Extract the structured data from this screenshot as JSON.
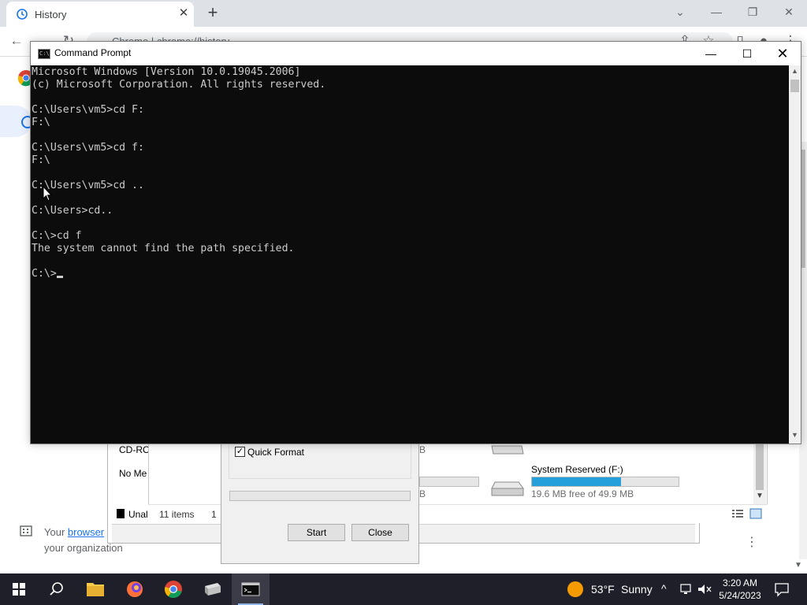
{
  "chrome": {
    "tab_title": "History",
    "address_partial": "Chrome  |  chrome://history"
  },
  "history_page": {
    "managed_text_prefix": "Your ",
    "managed_link": "browser",
    "managed_text_line2": "your organization"
  },
  "disk_management": {
    "cdrom_label": "CD-RO",
    "no_media_label": "No Me",
    "unallocated_label": "Unall",
    "unallocated_suffix": "1"
  },
  "explorer": {
    "items_count": "11 items",
    "drive_name": "System Reserved (F:)",
    "drive_free": "19.6 MB free of 49.9 MB",
    "drive_used_fraction": 0.607,
    "fragment_b1": "B",
    "fragment_b2": "B"
  },
  "format_dialog": {
    "quick_format_label": "Quick Format",
    "quick_format_checked": "✓",
    "start_button": "Start",
    "close_button": "Close"
  },
  "cmd": {
    "title": "Command Prompt",
    "icon_glyph": "C:\\",
    "lines": "Microsoft Windows [Version 10.0.19045.2006]\n(c) Microsoft Corporation. All rights reserved.\n\nC:\\Users\\vm5>cd F:\nF:\\\n\nC:\\Users\\vm5>cd f:\nF:\\\n\nC:\\Users\\vm5>cd ..\n\nC:\\Users>cd..\n\nC:\\>cd f\nThe system cannot find the path specified.\n\nC:\\>"
  },
  "taskbar": {
    "weather_temp": "53°F",
    "weather_desc": "Sunny",
    "time": "3:20 AM",
    "date": "5/24/2023"
  },
  "colors": {
    "console_bg": "#0c0c0c",
    "console_fg": "#cccccc",
    "taskbar_bg": "#1f1f2a",
    "accent_blue": "#26a0da"
  }
}
